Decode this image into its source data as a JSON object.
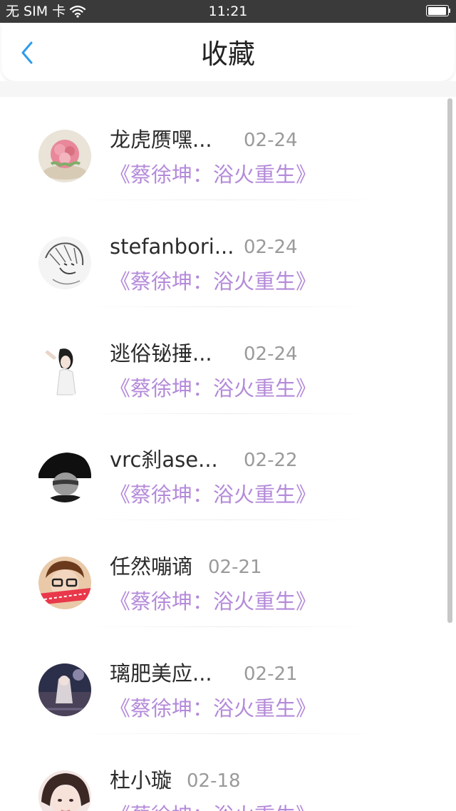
{
  "status_bar": {
    "carrier": "无 SIM 卡",
    "time": "11:21"
  },
  "header": {
    "title": "收藏"
  },
  "favorites": [
    {
      "name": "龙虎赝嘿...",
      "date": "02-24",
      "book": "《蔡徐坤：浴火重生》",
      "avatar": "flower-cup"
    },
    {
      "name": "stefanbori...",
      "date": "02-24",
      "book": "《蔡徐坤：浴火重生》",
      "avatar": "sketch-face"
    },
    {
      "name": "逃俗铋捶...",
      "date": "02-24",
      "book": "《蔡徐坤：浴火重生》",
      "avatar": "girl-portrait"
    },
    {
      "name": "vrc刹ase...",
      "date": "02-22",
      "book": "《蔡徐坤：浴火重生》",
      "avatar": "dark-hat-man"
    },
    {
      "name": "任然嘣谪",
      "date": "02-21",
      "book": "《蔡徐坤：浴火重生》",
      "avatar": "glasses-boy"
    },
    {
      "name": "璃肥美应...",
      "date": "02-21",
      "book": "《蔡徐坤：浴火重生》",
      "avatar": "night-scene"
    },
    {
      "name": "杜小璇",
      "date": "02-18",
      "book": "《蔡徐坤：浴火重生》",
      "avatar": "pink-girl"
    }
  ],
  "colors": {
    "accent": "#2f9bea",
    "book_title": "#b48ad9",
    "date": "#9a9a9a"
  }
}
